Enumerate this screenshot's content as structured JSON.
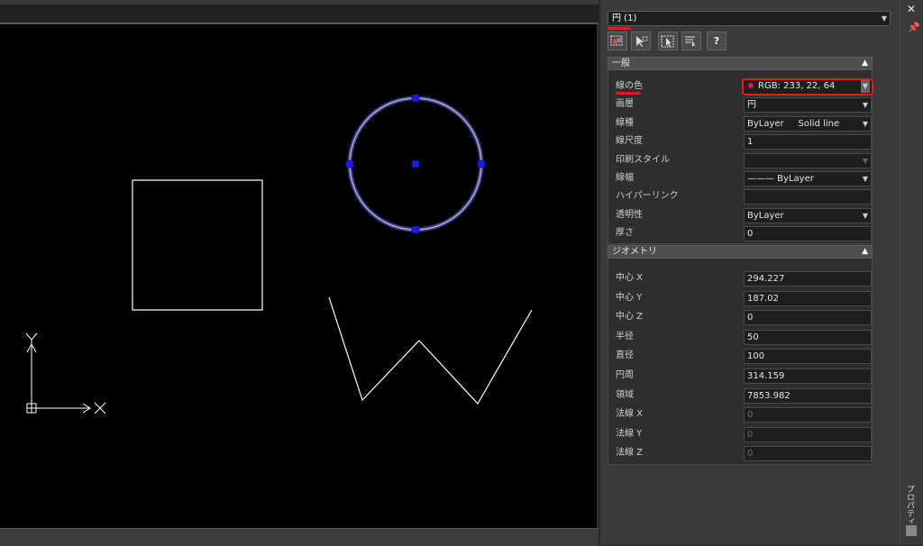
{
  "palette": {
    "object_select": "円 (1)",
    "toolbar": [
      "select-objects",
      "pick-add",
      "quick-select",
      "toggle-pickadd",
      "?"
    ],
    "general": {
      "title": "一般",
      "rows": [
        {
          "label": "線の色",
          "value": "RGB: 233, 22, 64"
        },
        {
          "label": "画層",
          "value": "円"
        },
        {
          "label": "線種",
          "value": "ByLayer     Solid line"
        },
        {
          "label": "線尺度",
          "value": "1"
        },
        {
          "label": "印刷スタイル",
          "value": ""
        },
        {
          "label": "線幅",
          "value": "——— ByLayer"
        },
        {
          "label": "ハイパーリンク",
          "value": ""
        },
        {
          "label": "透明性",
          "value": "ByLayer"
        },
        {
          "label": "厚さ",
          "value": "0"
        }
      ]
    },
    "geometry": {
      "title": "ジオメトリ",
      "rows": [
        {
          "label": "中心 X",
          "value": "294.227"
        },
        {
          "label": "中心 Y",
          "value": "187.02"
        },
        {
          "label": "中心 Z",
          "value": "0"
        },
        {
          "label": "半径",
          "value": "50"
        },
        {
          "label": "直径",
          "value": "100"
        },
        {
          "label": "円周",
          "value": "314.159"
        },
        {
          "label": "領域",
          "value": "7853.982"
        },
        {
          "label": "法線 X",
          "value": "0"
        },
        {
          "label": "法線 Y",
          "value": "0"
        },
        {
          "label": "法線 Z",
          "value": "0"
        }
      ]
    }
  },
  "side": {
    "tab_label": "プロパティ"
  },
  "colors": {
    "highlight": "#e21b1b",
    "color_dot": "#e91640",
    "grip": "#1a1aff",
    "circle": "#8a8ad8"
  }
}
